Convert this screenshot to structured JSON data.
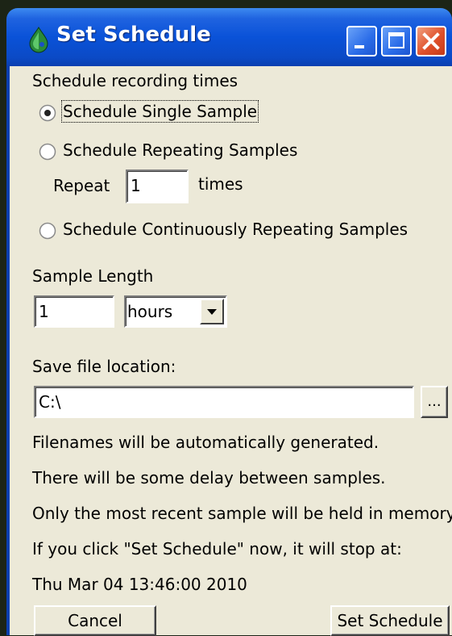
{
  "window": {
    "title": "Set Schedule",
    "icons": [
      "app-icon",
      "minimize-icon",
      "maximize-icon",
      "close-icon"
    ]
  },
  "schedule": {
    "heading": "Schedule recording times",
    "single_label": "Schedule Single Sample",
    "repeating_label": "Schedule Repeating Samples",
    "repeat_prefix": "Repeat",
    "repeat_count": "1",
    "repeat_suffix": "times",
    "continuous_label": "Schedule Continuously Repeating Samples",
    "selected": "single"
  },
  "sample_length": {
    "label": "Sample Length",
    "value": "1",
    "unit": "hours"
  },
  "save": {
    "label": "Save file location:",
    "path": "C:\\",
    "browse_label": "..."
  },
  "info": {
    "line1": "Filenames will be automatically generated.",
    "line2": "There will be some delay between samples.",
    "line3": "Only the most recent sample will be held in memory.",
    "line4": "If you click \"Set Schedule\" now, it will stop at:",
    "stop_time": "Thu Mar 04 13:46:00 2010"
  },
  "buttons": {
    "cancel": "Cancel",
    "set_schedule": "Set Schedule"
  },
  "colors": {
    "titlebar": "#0a52d8",
    "dialog_bg": "#ece9d8",
    "close_button": "#e0502a"
  }
}
